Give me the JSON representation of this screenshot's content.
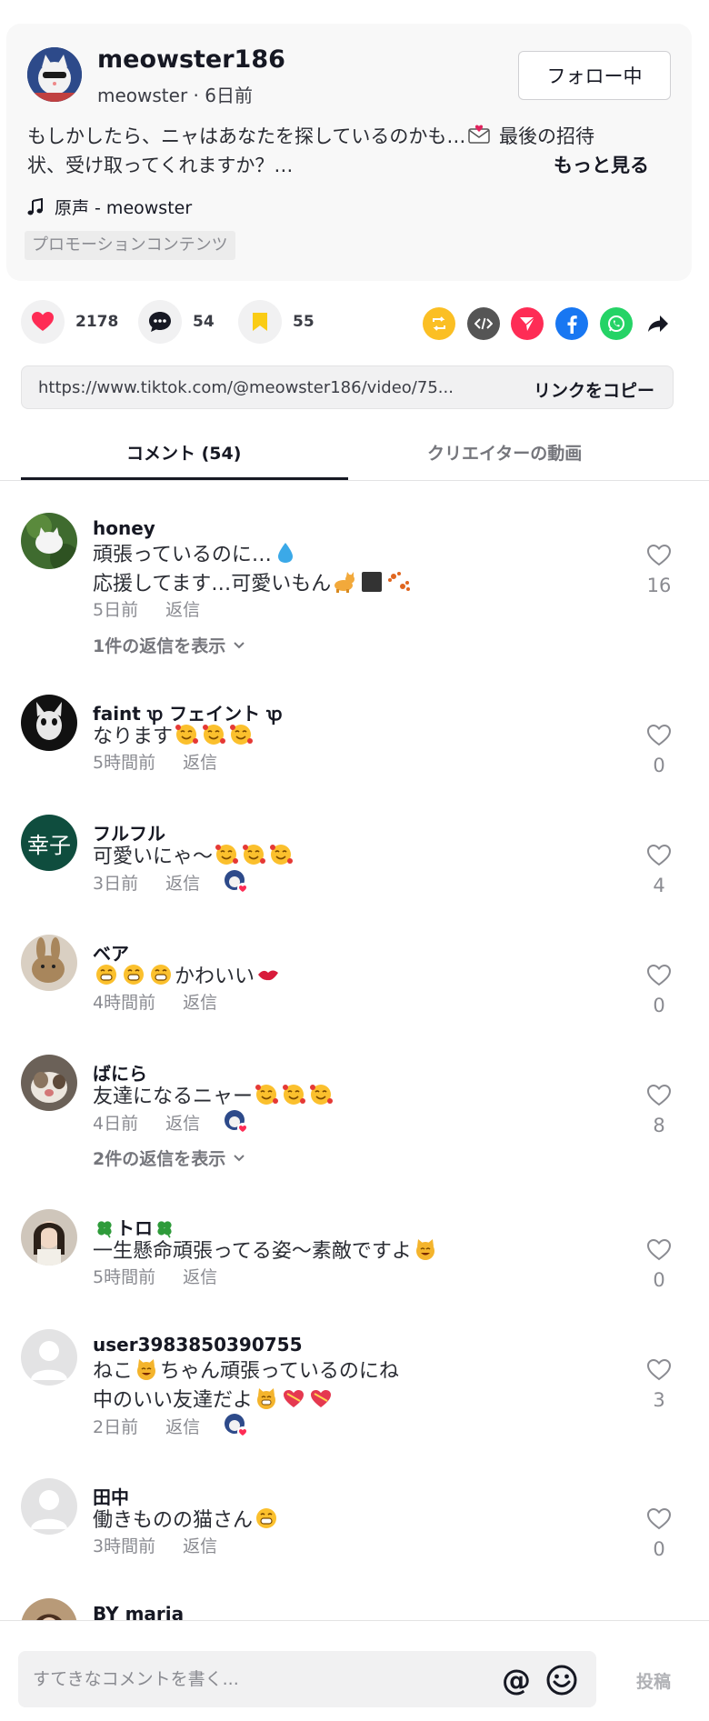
{
  "post": {
    "author_name": "meowster186",
    "author_sub": "meowster · 6日前",
    "follow_label": "フォロー中",
    "description_line1": "もしかしたら、ニャはあなたを探しているのかも…",
    "description_tail1": " 最後の招待",
    "description_line2": "状、受け取ってくれますか？…",
    "more_label": "もっと見る",
    "music": "原声 - meowster",
    "promo_tag": "プロモーションコンテンツ"
  },
  "actions": {
    "likes": "2178",
    "comments": "54",
    "saves": "55"
  },
  "share": {
    "url": "https://www.tiktok.com/@meowster186/video/75...",
    "copy_label": "リンクをコピー"
  },
  "tabs": {
    "comments_label": "コメント (54)",
    "creator_videos_label": "クリエイターの動画"
  },
  "comments": [
    {
      "name": "honey",
      "line1": "頑張っているのに…",
      "line2": "応援してます…可愛いもん",
      "time": "5日前",
      "reply": "返信",
      "likes": "16",
      "view_replies": "1件の返信を表示"
    },
    {
      "name": "faint ꝕ フェイント ꝕ",
      "line1": "なります",
      "time": "5時間前",
      "reply": "返信",
      "likes": "0"
    },
    {
      "name": "フルフル",
      "avatar_text": "幸子",
      "line1": "可愛いにゃ〜",
      "time": "3日前",
      "reply": "返信",
      "likes": "4"
    },
    {
      "name": "ベア",
      "line1": "かわいい",
      "time": "4時間前",
      "reply": "返信",
      "likes": "0"
    },
    {
      "name": "ばにら",
      "line1": "友達になるニャー",
      "time": "4日前",
      "reply": "返信",
      "likes": "8",
      "view_replies": "2件の返信を表示"
    },
    {
      "name": "トロ",
      "line1": "一生懸命頑張ってる姿〜素敵ですよ",
      "time": "5時間前",
      "reply": "返信",
      "likes": "0"
    },
    {
      "name": "user3983850390755",
      "line1a": "ねこ",
      "line1b": "ちゃん頑張っているのにね",
      "line2": "中のいい友達だよ",
      "time": "2日前",
      "reply": "返信",
      "likes": "3"
    },
    {
      "name": "田中",
      "line1": "働きものの猫さん",
      "time": "3時間前",
      "reply": "返信",
      "likes": "0"
    },
    {
      "name": "BY maria"
    }
  ],
  "composer": {
    "placeholder": "すてきなコメントを書く...",
    "at_label": "@",
    "post_label": "投稿"
  },
  "colors": {
    "like_red": "#fe2c55",
    "save_yellow": "#facc15",
    "repost_orange": "#fbbf24",
    "embed_gray": "#555555",
    "send_red": "#fe2c55",
    "facebook_blue": "#1877f2",
    "whatsapp_green": "#25d366"
  }
}
